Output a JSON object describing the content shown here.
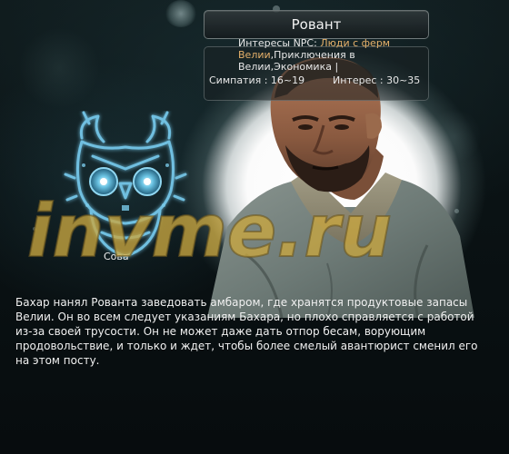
{
  "npc": {
    "name": "Ровант",
    "interests_label": "Интересы NPC:",
    "interests_parts": [
      {
        "text": "Люди с ферм ",
        "highlight": true
      },
      {
        "text": "Велии",
        "highlight": true
      },
      {
        "text": ",Приключения в ",
        "highlight": false
      },
      {
        "text": "Велии",
        "highlight": false
      },
      {
        "text": ",Экономика |",
        "highlight": false
      }
    ],
    "sympathy": "Симпатия : 16~19",
    "interest_range": "Интерес : 30~35",
    "description": "Бахар нанял Ровантa заведовать амбаром, где хранятся продуктовые запасы Велии. Он во всем следует указаниям Бахара, но плохо справляется с работой из-за своей трусости. Он не может даже дать отпор бесам, ворующим продовольствие, и только и ждет, чтобы более смелый авантюрист сменил его на этом посту."
  },
  "emblem": {
    "label": "Сова",
    "icon": "owl-icon",
    "color": "#7fc6e0"
  },
  "watermark": {
    "text": "invme.ru",
    "color": "#c9a640"
  },
  "colors": {
    "highlight": "#e5b06a",
    "text": "#f0f0f0"
  }
}
